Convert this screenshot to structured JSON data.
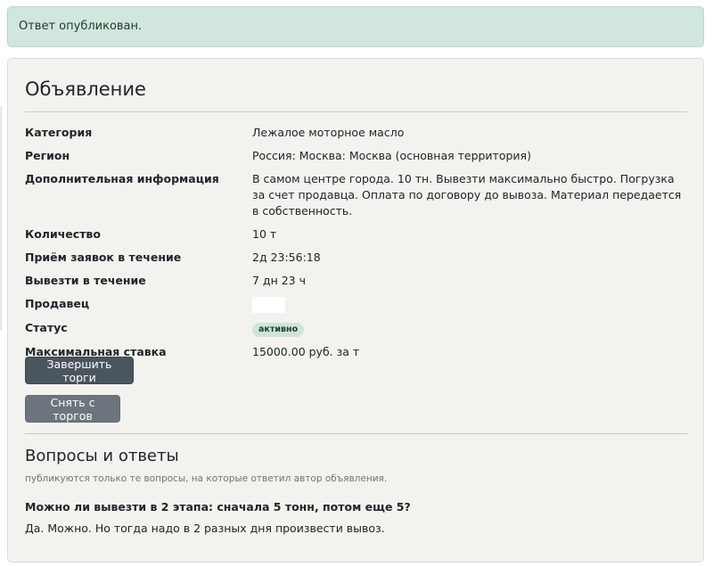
{
  "alert": {
    "text": "Ответ опубликован."
  },
  "listing": {
    "title": "Объявление",
    "rows": [
      {
        "label": "Категория",
        "value": "Лежалое моторное масло"
      },
      {
        "label": "Регион",
        "value": "Россия: Москва: Москва (основная территория)"
      },
      {
        "label": "Дополнительная информация",
        "value": "В самом центре города. 10 тн. Вывезти максимально быстро. Погрузка за счет продавца. Оплата по договору до вывоза. Материал передается в собственность."
      },
      {
        "label": "Количество",
        "value": "10 т"
      },
      {
        "label": "Приём заявок в течение",
        "value": "2д 23:56:18"
      },
      {
        "label": "Вывезти в течение",
        "value": "7 дн 23 ч"
      },
      {
        "label": "Продавец",
        "value": ""
      },
      {
        "label": "Статус",
        "value": "активно"
      },
      {
        "label": "Максимальная ставка",
        "value": "15000.00 руб. за т"
      }
    ],
    "buttons": {
      "finish": "Завершить торги",
      "withdraw": "Снять с торгов"
    }
  },
  "qa": {
    "title": "Вопросы и ответы",
    "subtitle": "публикуются только те вопросы, на которые ответил автор объявления.",
    "items": [
      {
        "question": "Можно ли вывезти в 2 этапа: сначала 5 тонн, потом еще 5?",
        "answer": "Да. Можно. Но тогда надо в 2 разных дня произвести вывоз."
      }
    ]
  },
  "colors": {
    "alert_bg": "#d1e7dd",
    "card_bg": "#f3f2ef",
    "btn_dark": "#4b555e",
    "btn_gray": "#6c757d",
    "badge_bg": "#cfe5dc"
  }
}
